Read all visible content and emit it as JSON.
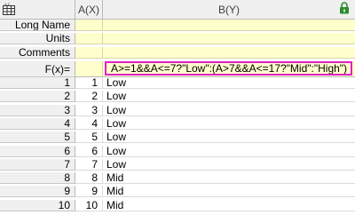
{
  "header": {
    "col_a": "A(X)",
    "col_b": "B(Y)"
  },
  "meta_rows": {
    "long_name": "Long Name",
    "units": "Units",
    "comments": "Comments",
    "fx": "F(x)="
  },
  "formula": "A>=1&&A<=7?\"Low\":(A>7&&A<=17?\"Mid\":\"High\")",
  "rows": [
    {
      "index": "1",
      "a": "1",
      "b": "Low"
    },
    {
      "index": "2",
      "a": "2",
      "b": "Low"
    },
    {
      "index": "3",
      "a": "3",
      "b": "Low"
    },
    {
      "index": "4",
      "a": "4",
      "b": "Low"
    },
    {
      "index": "5",
      "a": "5",
      "b": "Low"
    },
    {
      "index": "6",
      "a": "6",
      "b": "Low"
    },
    {
      "index": "7",
      "a": "7",
      "b": "Low"
    },
    {
      "index": "8",
      "a": "8",
      "b": "Mid"
    },
    {
      "index": "9",
      "a": "9",
      "b": "Mid"
    },
    {
      "index": "10",
      "a": "10",
      "b": "Mid"
    }
  ],
  "icons": {
    "corner": "worksheet-grid-icon",
    "lock": "lock-icon"
  },
  "colors": {
    "meta_background": "#ffffcc",
    "formula_highlight": "#e020c8",
    "lock_green": "#2e8b2e"
  }
}
